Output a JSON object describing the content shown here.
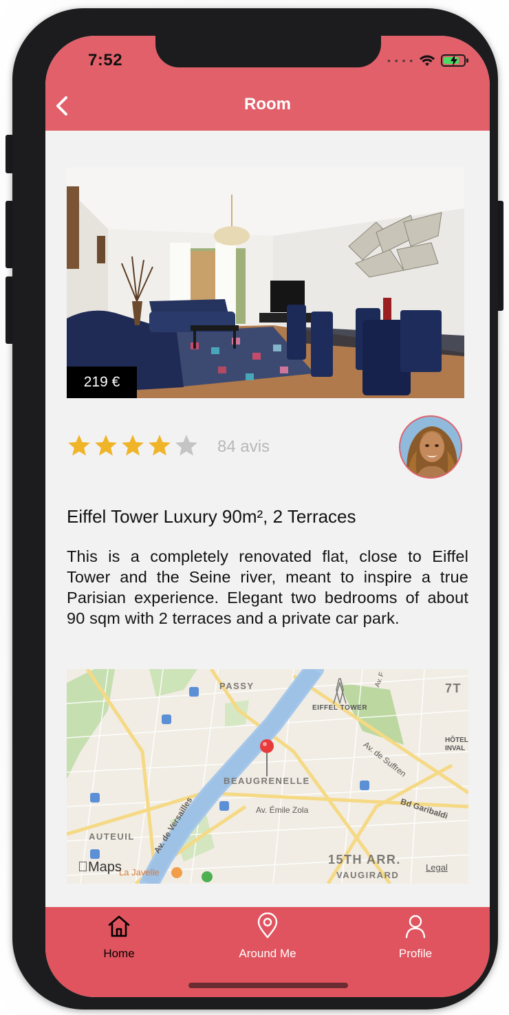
{
  "status_bar": {
    "time": "7:52"
  },
  "nav": {
    "title": "Room"
  },
  "room": {
    "price": "219 €",
    "rating": 4,
    "rating_max": 5,
    "reviews": "84 avis",
    "title": "Eiffel Tower Luxury 90m², 2 Terraces",
    "description": "This is a completely renovated flat, close to Eiffel Tower and the Seine river, meant to inspire a true Parisian experience. Elegant two bedrooms of about 90 sqm with 2 terraces and a private car park."
  },
  "map": {
    "labels": {
      "passy": "PASSY",
      "eiffel": "EIFFEL TOWER",
      "beaugrenelle": "BEAUGRENELLE",
      "auteuil": "AUTEUIL",
      "arr15": "15TH ARR.",
      "vaugirard": "VAUGIRARD",
      "hotel1": "HÔTEL",
      "hotel2": "INVAL",
      "seventh": "7T"
    },
    "roads": {
      "suffren": "Av. de Suffren",
      "garibaldi": "Bd Garibaldi",
      "zola": "Av. Émile Zola",
      "versailles": "Av. de Versailles",
      "av_top": "Av. F",
      "javelle": "La Javelle"
    },
    "brand": "Maps",
    "legal": "Legal"
  },
  "tabs": [
    {
      "label": "Home",
      "icon": "home-icon",
      "active": true
    },
    {
      "label": "Around Me",
      "icon": "location-pin-icon",
      "active": false
    },
    {
      "label": "Profile",
      "icon": "person-icon",
      "active": false
    }
  ],
  "colors": {
    "header": "#e1606a",
    "tabbar": "#e0545f",
    "star_filled": "#f0b429",
    "star_empty": "#c4c4c4",
    "tab_active": "#000000",
    "tab_inactive": "#ffffff"
  }
}
